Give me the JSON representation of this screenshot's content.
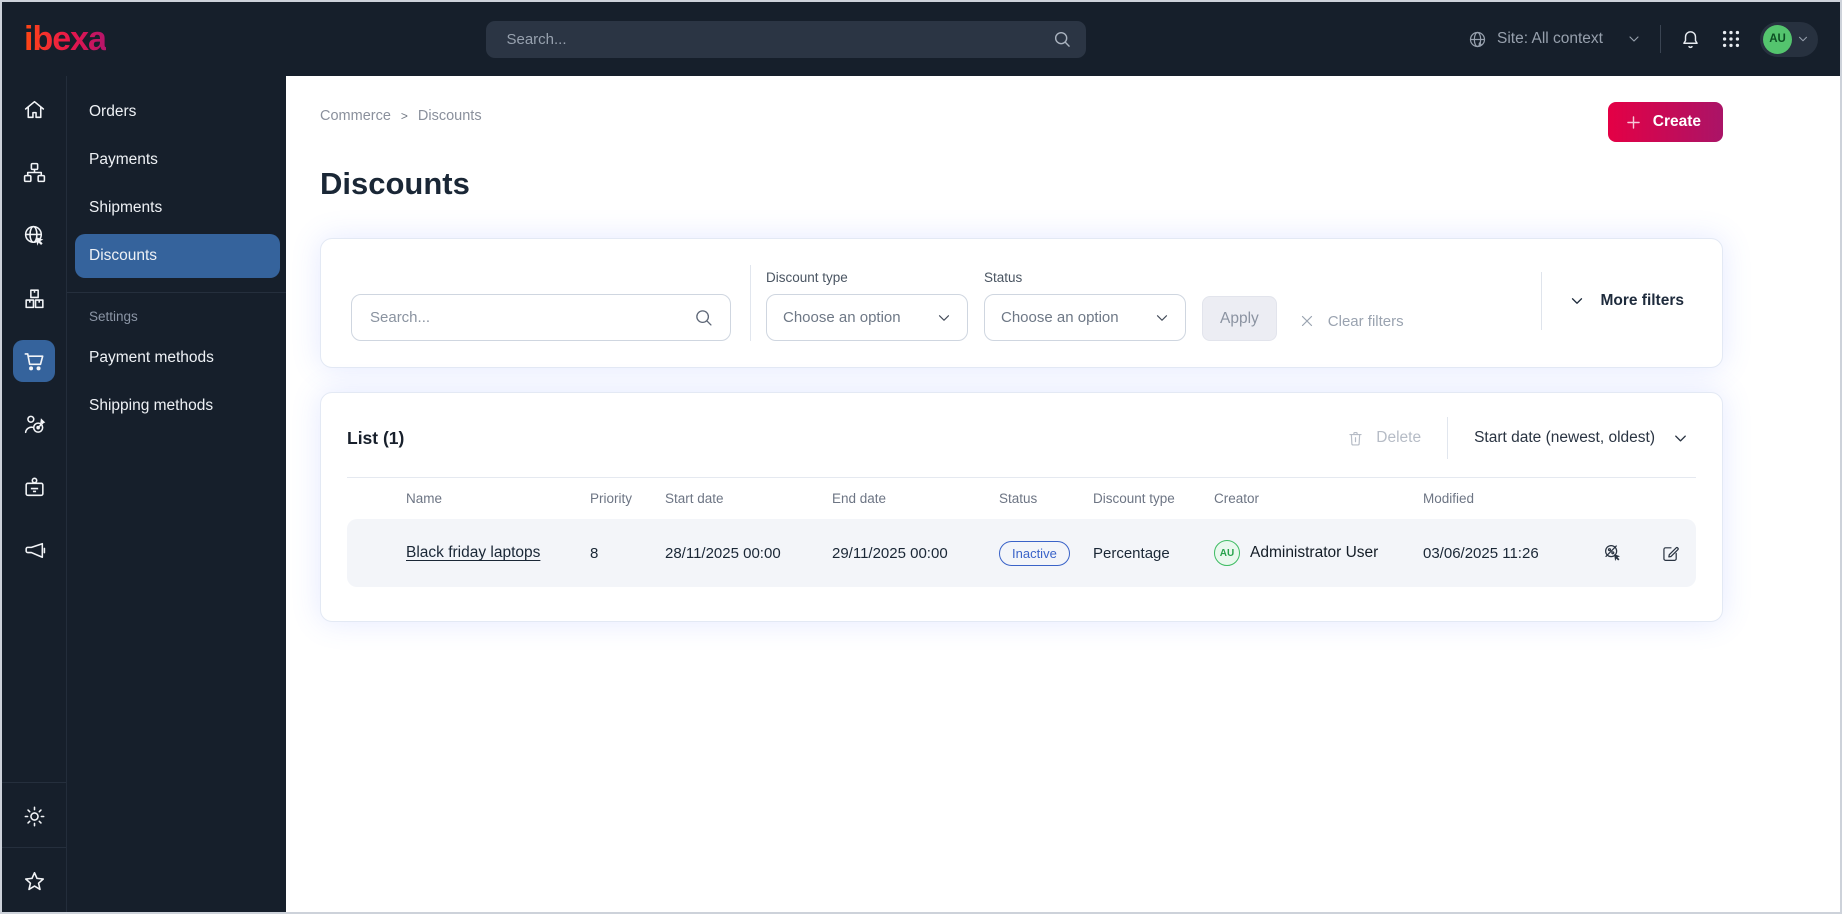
{
  "topbar": {
    "logo": "ibexa",
    "search_placeholder": "Search...",
    "site_selector_label": "Site: All context",
    "avatar_initials": "AU",
    "icons": [
      "globe-icon",
      "chevron-down-icon",
      "bell-icon",
      "app-grid-icon"
    ]
  },
  "sidebar": {
    "icons": [
      "home-icon",
      "sitemap-icon",
      "globe-pointer-icon",
      "product-boxes-icon",
      "shopping-cart-icon",
      "customer-target-icon",
      "id-badge-icon",
      "megaphone-icon"
    ],
    "active_icon": "shopping-cart-icon",
    "bottom_icons": [
      "gear-icon",
      "star-icon"
    ]
  },
  "menu": {
    "items": [
      {
        "label": "Orders"
      },
      {
        "label": "Payments"
      },
      {
        "label": "Shipments"
      },
      {
        "label": "Discounts"
      }
    ],
    "active_item": "Discounts",
    "section_label": "Settings",
    "settings_items": [
      {
        "label": "Payment methods"
      },
      {
        "label": "Shipping methods"
      }
    ]
  },
  "breadcrumb": {
    "items": [
      "Commerce",
      "Discounts"
    ],
    "separator": ">"
  },
  "page": {
    "title": "Discounts",
    "create_label": "Create"
  },
  "filters": {
    "search_placeholder": "Search...",
    "discount_type_label": "Discount type",
    "discount_type_value": "Choose an option",
    "status_label": "Status",
    "status_value": "Choose an option",
    "apply_label": "Apply",
    "clear_label": "Clear filters",
    "more_filters_label": "More filters"
  },
  "list": {
    "title": "List (1)",
    "delete_label": "Delete",
    "sort_label": "Start date (newest, oldest)",
    "columns": [
      "Name",
      "Priority",
      "Start date",
      "End date",
      "Status",
      "Discount type",
      "Creator",
      "Modified"
    ],
    "rows": [
      {
        "name": "Black friday laptops",
        "priority": "8",
        "start_date": "28/11/2025 00:00",
        "end_date": "29/11/2025 00:00",
        "status": "Inactive",
        "discount_type": "Percentage",
        "creator_initials": "AU",
        "creator": "Administrator User",
        "modified": "03/06/2025 11:26",
        "action_icons": [
          "percent-slash-cursor-icon",
          "edit-icon"
        ]
      }
    ]
  },
  "colors": {
    "topbar_bg": "#161f2b",
    "active_blue": "#35639c",
    "brand_gradient_start": "#e40045",
    "brand_gradient_end": "#aa1467",
    "logo_gradient": [
      "#ff4713",
      "#b4156b"
    ],
    "status_inactive_blue": "#3a63c8",
    "avatar_green": "#54c46e",
    "row_bg": "#f3f5f9"
  }
}
